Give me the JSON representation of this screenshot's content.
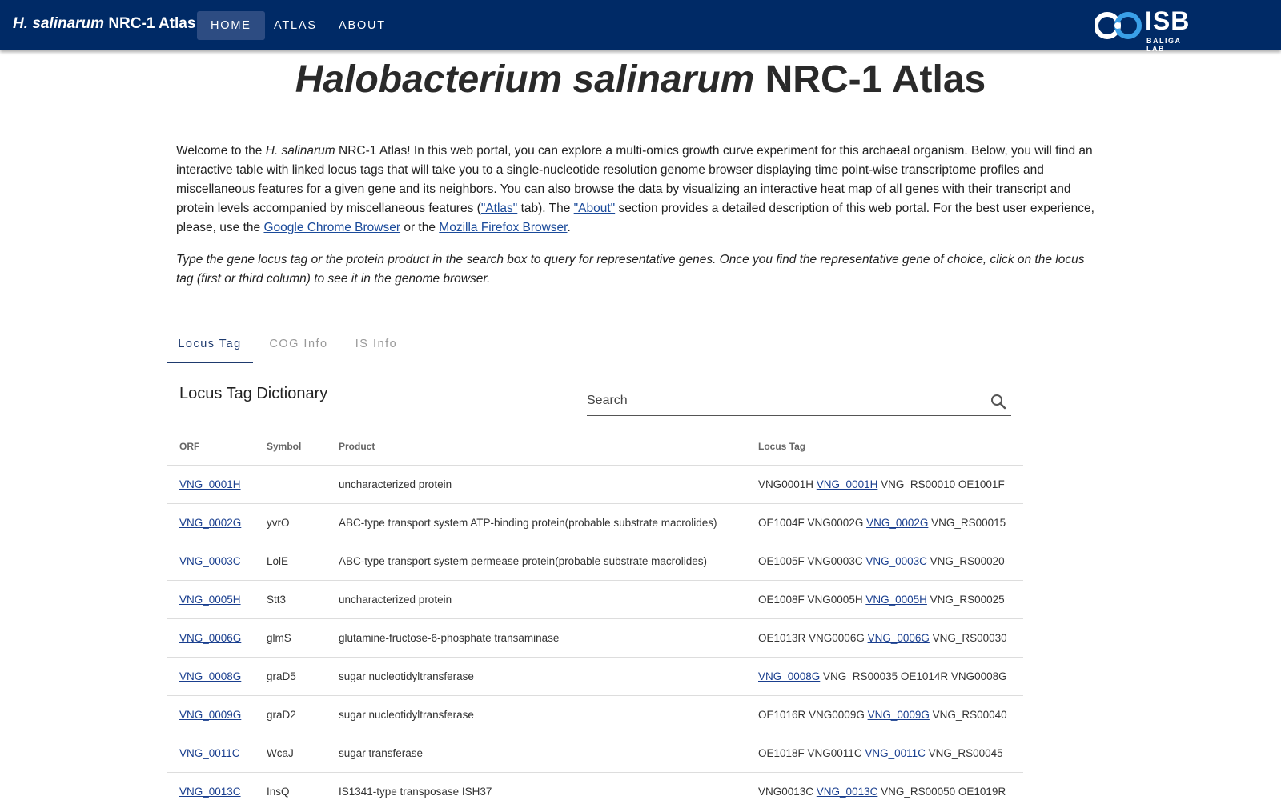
{
  "appbar": {
    "brand_italic": "H. salinarum",
    "brand_rest": " NRC-1 Atlas",
    "nav": [
      {
        "label": "Home",
        "active": true
      },
      {
        "label": "Atlas",
        "active": false
      },
      {
        "label": "About",
        "active": false
      }
    ],
    "logo_text": "ISB",
    "logo_sub": "BALIGA LAB"
  },
  "page": {
    "title_italic": "Halobacterium salinarum",
    "title_rest": " NRC-1 Atlas",
    "intro": {
      "p1": "Welcome to the ",
      "p1_italic": "H. salinarum",
      "p2": " NRC-1 Atlas! In this web portal, you can explore a multi-omics growth curve experiment for this archaeal organism. Below, you will find an interactive table with linked locus tags that will take you to a single-nucleotide resolution genome browser displaying time point-wise transcriptome profiles and miscellaneous features for a given gene and its neighbors. You can also browse the data by visualizing an interactive heat map of all genes with their transcript and protein levels accompanied by miscellaneous features (",
      "atlas_link": "\"Atlas\"",
      "p3": " tab). The ",
      "about_link": "\"About\"",
      "p4": " section provides a detailed description of this web portal. For the best user experience, please, use the ",
      "chrome_link": "Google Chrome Browser",
      "p5": " or the ",
      "firefox_link": "Mozilla Firefox Browser",
      "p6": "."
    },
    "hint": "Type the gene locus tag or the protein product in the search box to query for representative genes. Once you find the representative gene of choice, click on the locus tag (first or third column) to see it in the genome browser."
  },
  "tabs": [
    {
      "label": "Locus Tag",
      "active": true
    },
    {
      "label": "COG Info",
      "active": false
    },
    {
      "label": "IS Info",
      "active": false
    }
  ],
  "dictionary": {
    "title": "Locus Tag Dictionary",
    "search_placeholder": "Search",
    "columns": [
      "ORF",
      "Symbol",
      "Product",
      "Locus Tag"
    ],
    "rows": [
      {
        "orf": "VNG_0001H",
        "symbol": "",
        "product": "uncharacterized protein",
        "locus": [
          {
            "t": "VNG0001H ",
            "link": false
          },
          {
            "t": "VNG_0001H",
            "link": true
          },
          {
            "t": " VNG_RS00010 OE1001F",
            "link": false
          }
        ]
      },
      {
        "orf": "VNG_0002G",
        "symbol": "yvrO",
        "product": "ABC-type transport system ATP-binding protein(probable substrate macrolides)",
        "locus": [
          {
            "t": "OE1004F VNG0002G ",
            "link": false
          },
          {
            "t": "VNG_0002G",
            "link": true
          },
          {
            "t": " VNG_RS00015",
            "link": false
          }
        ]
      },
      {
        "orf": "VNG_0003C",
        "symbol": "LolE",
        "product": "ABC-type transport system permease protein(probable substrate macrolides)",
        "locus": [
          {
            "t": "OE1005F VNG0003C ",
            "link": false
          },
          {
            "t": "VNG_0003C",
            "link": true
          },
          {
            "t": " VNG_RS00020",
            "link": false
          }
        ]
      },
      {
        "orf": "VNG_0005H",
        "symbol": "Stt3",
        "product": "uncharacterized protein",
        "locus": [
          {
            "t": "OE1008F VNG0005H ",
            "link": false
          },
          {
            "t": "VNG_0005H",
            "link": true
          },
          {
            "t": " VNG_RS00025",
            "link": false
          }
        ]
      },
      {
        "orf": "VNG_0006G",
        "symbol": "glmS",
        "product": "glutamine-fructose-6-phosphate transaminase",
        "locus": [
          {
            "t": "OE1013R VNG0006G ",
            "link": false
          },
          {
            "t": "VNG_0006G",
            "link": true
          },
          {
            "t": " VNG_RS00030",
            "link": false
          }
        ]
      },
      {
        "orf": "VNG_0008G",
        "symbol": "graD5",
        "product": "sugar nucleotidyltransferase",
        "locus": [
          {
            "t": "VNG_0008G",
            "link": true
          },
          {
            "t": " VNG_RS00035 OE1014R VNG0008G",
            "link": false
          }
        ]
      },
      {
        "orf": "VNG_0009G",
        "symbol": "graD2",
        "product": "sugar nucleotidyltransferase",
        "locus": [
          {
            "t": "OE1016R VNG0009G ",
            "link": false
          },
          {
            "t": "VNG_0009G",
            "link": true
          },
          {
            "t": " VNG_RS00040",
            "link": false
          }
        ]
      },
      {
        "orf": "VNG_0011C",
        "symbol": "WcaJ",
        "product": "sugar transferase",
        "locus": [
          {
            "t": "OE1018F VNG0011C ",
            "link": false
          },
          {
            "t": "VNG_0011C",
            "link": true
          },
          {
            "t": " VNG_RS00045",
            "link": false
          }
        ]
      },
      {
        "orf": "VNG_0013C",
        "symbol": "InsQ",
        "product": "IS1341-type transposase ISH37",
        "locus": [
          {
            "t": "VNG0013C ",
            "link": false
          },
          {
            "t": "VNG_0013C",
            "link": true
          },
          {
            "t": " VNG_RS00050 OE1019R",
            "link": false
          }
        ]
      }
    ]
  },
  "colors": {
    "appbar": "#002a66",
    "nav_active": "#2d4c82",
    "link": "#1a3f8f",
    "tab_active": "#1e3a6e"
  },
  "icons": [
    "search-icon",
    "isb-logo-icon"
  ]
}
